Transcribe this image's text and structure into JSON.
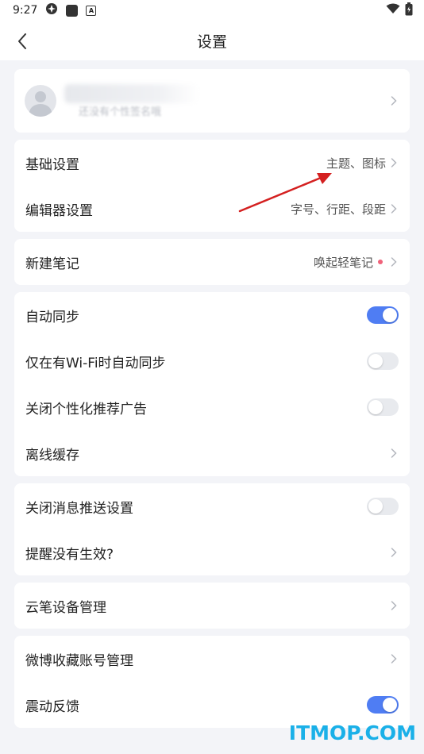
{
  "status_bar": {
    "time": "9:27",
    "icon_a": "A"
  },
  "header": {
    "title": "设置"
  },
  "profile": {
    "subtitle": "还没有个性签名哦"
  },
  "basic": {
    "basic_settings": {
      "label": "基础设置",
      "value": "主题、图标"
    },
    "editor_settings": {
      "label": "编辑器设置",
      "value": "字号、行距、段距"
    }
  },
  "new_note": {
    "label": "新建笔记",
    "value": "唤起轻笔记"
  },
  "sync": {
    "auto_sync": {
      "label": "自动同步",
      "on": true
    },
    "wifi_only": {
      "label": "仅在有Wi-Fi时自动同步",
      "on": false
    },
    "close_ads": {
      "label": "关闭个性化推荐广告",
      "on": false
    },
    "offline_cache": {
      "label": "离线缓存"
    }
  },
  "push": {
    "close_push": {
      "label": "关闭消息推送设置",
      "on": false
    },
    "reminder": {
      "label": "提醒没有生效?"
    }
  },
  "pen": {
    "label": "云笔设备管理"
  },
  "misc": {
    "weibo": {
      "label": "微博收藏账号管理"
    },
    "vibration": {
      "label": "震动反馈",
      "on": true
    }
  },
  "watermark": "ITMOP.COM",
  "colors": {
    "accent": "#4f7df3",
    "badge": "#f0627a",
    "watermark": "#1ab0e8",
    "arrow": "#d42020"
  }
}
